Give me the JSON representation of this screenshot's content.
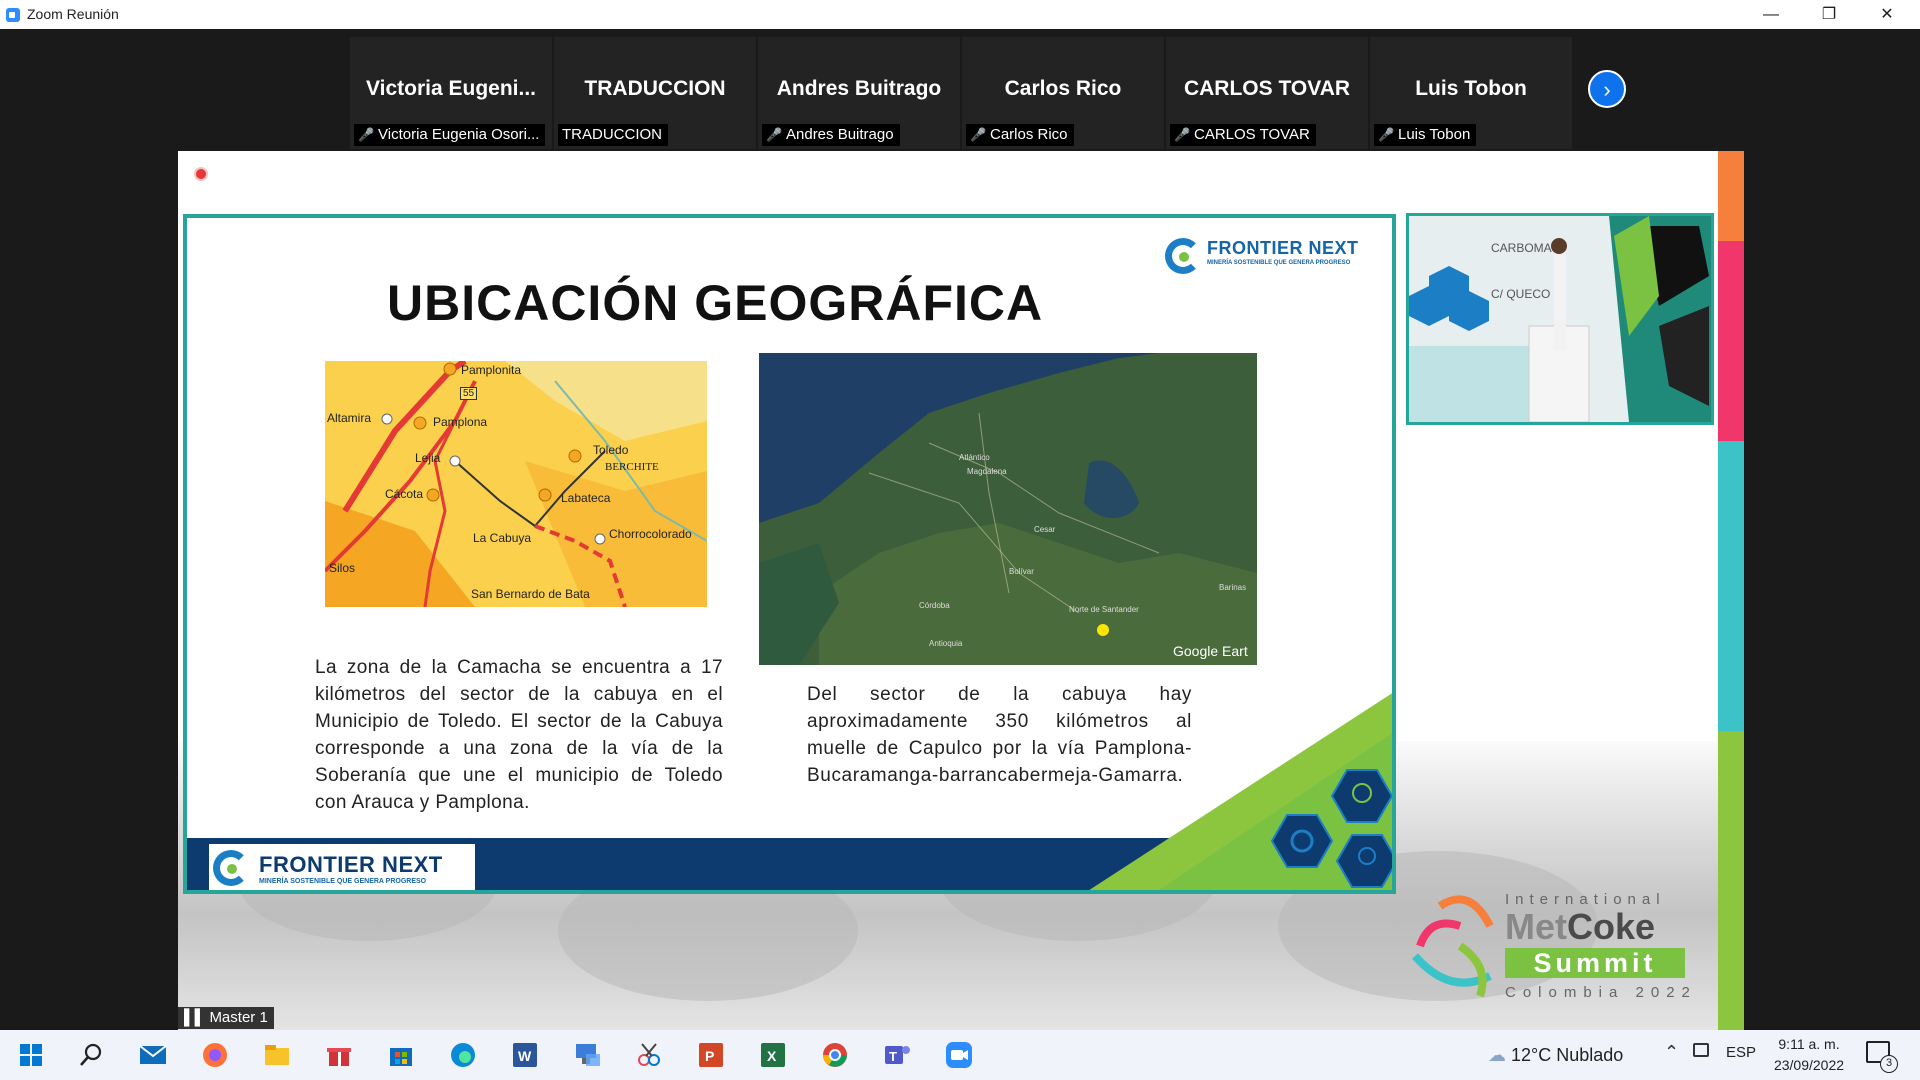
{
  "window": {
    "title": "Zoom Reunión"
  },
  "participants": [
    {
      "tile_name": "Victoria  Eugeni...",
      "label": "Victoria Eugenia Osori...",
      "muted": true
    },
    {
      "tile_name": "TRADUCCION",
      "label": "TRADUCCION",
      "muted": false
    },
    {
      "tile_name": "Andres Buitrago",
      "label": "Andres Buitrago",
      "muted": true
    },
    {
      "tile_name": "Carlos Rico",
      "label": "Carlos Rico",
      "muted": true
    },
    {
      "tile_name": "CARLOS TOVAR",
      "label": "CARLOS TOVAR",
      "muted": true
    },
    {
      "tile_name": "Luis Tobon",
      "label": "Luis Tobon",
      "muted": true
    }
  ],
  "slide": {
    "title": "UBICACIÓN GEOGRÁFICA",
    "logo_name": "FRONTIER NEXT",
    "logo_tagline": "MINERÍA SOSTENIBLE QUE GENERA PROGRESO",
    "text_left": "La zona de la Camacha se encuentra a 17 kilómetros del sector de la cabuya en el Municipio de Toledo. El sector de la Cabuya corresponde a una zona de la vía de la Soberanía que une el municipio de Toledo con Arauca y Pamplona.",
    "text_right": "Del sector de la cabuya hay aproximadamente 350 kilómetros al muelle de Capulco por la vía Pamplona-Bucaramanga-barrancabermeja-Gamarra.",
    "map_left_labels": {
      "pamplonita": "Pamplonita",
      "road_55": "55",
      "altamira": "Altamira",
      "pamplona": "Pamplona",
      "lejia": "Lejia",
      "toledo": "Toledo",
      "berchite": "BERCHITE",
      "cacota": "Cácota",
      "labateca": "Labateca",
      "la_cabuya": "La Cabuya",
      "chorrocolorado": "Chorrocolorado",
      "silos": "Silos",
      "san_bernardo": "San Bernardo de Bata"
    },
    "map_right_labels": {
      "atlantico": "Atlántico",
      "magdalena": "Magdalena",
      "cesar": "Cesar",
      "bolivar": "Bolívar",
      "cordoba": "Córdoba",
      "norte_santander": "Norte de Santander",
      "antioquia": "Antioquia",
      "barinas": "Barinas",
      "watermark": "Google Eart"
    }
  },
  "summit": {
    "line1": "International",
    "met": "Met",
    "coke": "Coke",
    "summit": "Summit",
    "country": "Colombia 2022"
  },
  "share_tag": "Master 1",
  "taskbar": {
    "weather": "12°C  Nublado",
    "language": "ESP",
    "time": "9:11 a. m.",
    "date": "23/09/2022",
    "notifications": "3"
  },
  "colors": {
    "zoom_blue": "#0e72ed",
    "slide_teal": "#26a69a",
    "slide_navy": "#0d3b6f",
    "slide_green": "#7cc242"
  }
}
